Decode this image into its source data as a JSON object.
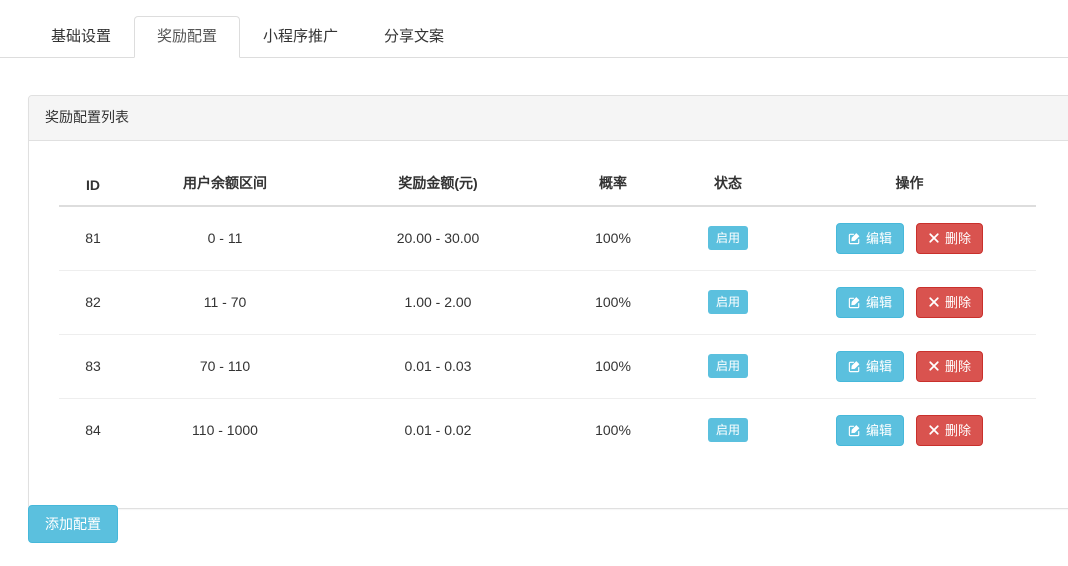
{
  "tabs": [
    {
      "label": "基础设置",
      "active": false
    },
    {
      "label": "奖励配置",
      "active": true
    },
    {
      "label": "小程序推广",
      "active": false
    },
    {
      "label": "分享文案",
      "active": false
    }
  ],
  "panel": {
    "heading": "奖励配置列表"
  },
  "table": {
    "headers": [
      "ID",
      "用户余额区间",
      "奖励金额(元)",
      "概率",
      "状态",
      "操作"
    ],
    "rows": [
      {
        "id": "81",
        "balance_range": "0 - 11",
        "reward_amount": "20.00 - 30.00",
        "probability": "100%",
        "status": "启用",
        "edit_label": "编辑",
        "delete_label": "删除"
      },
      {
        "id": "82",
        "balance_range": "11 - 70",
        "reward_amount": "1.00 - 2.00",
        "probability": "100%",
        "status": "启用",
        "edit_label": "编辑",
        "delete_label": "删除"
      },
      {
        "id": "83",
        "balance_range": "70 - 110",
        "reward_amount": "0.01 - 0.03",
        "probability": "100%",
        "status": "启用",
        "edit_label": "编辑",
        "delete_label": "删除"
      },
      {
        "id": "84",
        "balance_range": "110 - 1000",
        "reward_amount": "0.01 - 0.02",
        "probability": "100%",
        "status": "启用",
        "edit_label": "编辑",
        "delete_label": "删除"
      }
    ]
  },
  "footer": {
    "add_label": "添加配置"
  },
  "icons": {
    "edit": "pencil-square-icon",
    "delete": "remove-icon"
  },
  "colors": {
    "info": "#5bc0de",
    "danger": "#d9534f",
    "panel_heading_bg": "#f5f5f5",
    "border": "#dddddd"
  }
}
